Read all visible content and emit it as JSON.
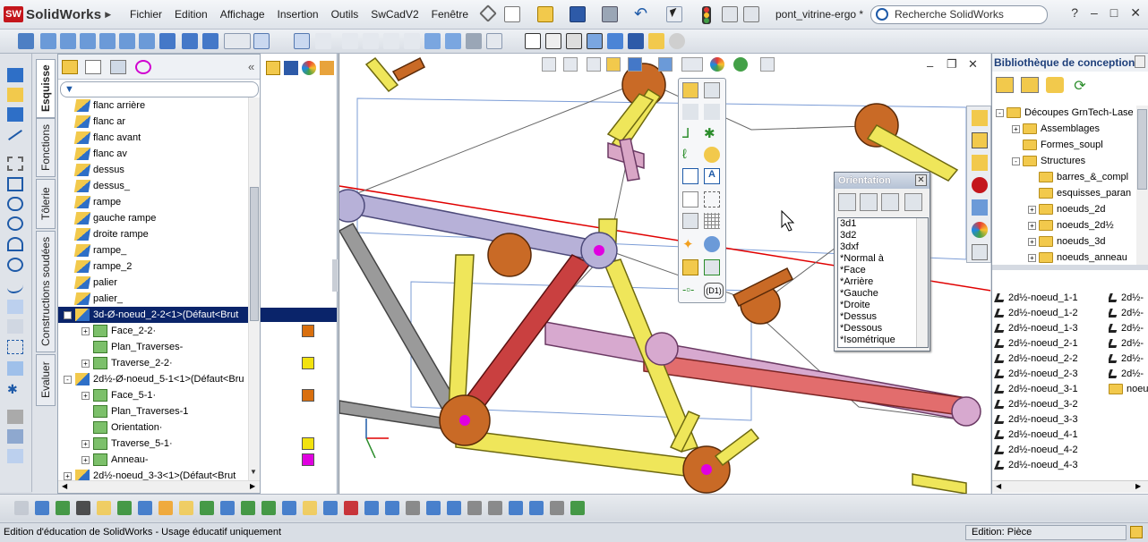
{
  "app": {
    "logo_badge": "SW",
    "name": "SolidWorks",
    "document_title": "pont_vitrine-ergo *"
  },
  "menu": [
    "Fichier",
    "Edition",
    "Affichage",
    "Insertion",
    "Outils",
    "SwCadV2",
    "Fenêtre"
  ],
  "search": {
    "placeholder": "Recherche SolidWorks"
  },
  "window_controls": [
    "?",
    "–",
    "□",
    "✕"
  ],
  "left_tabs": [
    "Esquisse",
    "Fonctions",
    "Tôlerie",
    "Constructions soudées",
    "Evaluer"
  ],
  "tree": [
    {
      "label": "flanc arrière",
      "indent": 0
    },
    {
      "label": "flanc ar",
      "indent": 0
    },
    {
      "label": "flanc avant",
      "indent": 0
    },
    {
      "label": "flanc av",
      "indent": 0
    },
    {
      "label": "dessus",
      "indent": 0
    },
    {
      "label": "dessus_",
      "indent": 0
    },
    {
      "label": "rampe",
      "indent": 0
    },
    {
      "label": "gauche rampe",
      "indent": 0
    },
    {
      "label": "droite rampe",
      "indent": 0
    },
    {
      "label": "rampe_",
      "indent": 0
    },
    {
      "label": "rampe_2",
      "indent": 0
    },
    {
      "label": "palier",
      "indent": 0
    },
    {
      "label": "palier_",
      "indent": 0
    },
    {
      "label": "3d-Ø-noeud_2-2<1>(Défaut<Brut",
      "indent": 0,
      "selected": true,
      "expander": "-"
    },
    {
      "label": "Face_2-2·",
      "indent": 1,
      "expander": "+"
    },
    {
      "label": "Plan_Traverses-",
      "indent": 1
    },
    {
      "label": "Traverse_2-2·",
      "indent": 1,
      "expander": "+"
    },
    {
      "label": "2d½-Ø-noeud_5-1<1>(Défaut<Bru",
      "indent": 0,
      "expander": "-"
    },
    {
      "label": "Face_5-1·",
      "indent": 1,
      "expander": "+"
    },
    {
      "label": "Plan_Traverses-1",
      "indent": 1
    },
    {
      "label": "Orientation·",
      "indent": 1
    },
    {
      "label": "Traverse_5-1·",
      "indent": 1,
      "expander": "+"
    },
    {
      "label": "Anneau-",
      "indent": 1,
      "expander": "+"
    },
    {
      "label": "2d½-noeud_3-3<1>(Défaut<Brut",
      "indent": 0,
      "expander": "+"
    }
  ],
  "orientation_dialog": {
    "title": "Orientation",
    "views": [
      "3d1",
      "3d2",
      "3dxf",
      "*Normal à",
      "*Face",
      "*Arrière",
      "*Gauche",
      "*Droite",
      "*Dessus",
      "*Dessous",
      "*Isométrique"
    ]
  },
  "library": {
    "title": "Bibliothèque de conception",
    "tree": [
      {
        "label": "Découpes GrnTech-Lase",
        "indent": 0,
        "expander": "-"
      },
      {
        "label": "Assemblages",
        "indent": 1,
        "expander": "+"
      },
      {
        "label": "Formes_soupl",
        "indent": 1
      },
      {
        "label": "Structures",
        "indent": 1,
        "expander": "-"
      },
      {
        "label": "barres_&_compl",
        "indent": 2
      },
      {
        "label": "esquisses_paran",
        "indent": 2
      },
      {
        "label": "noeuds_2d",
        "indent": 2,
        "expander": "+"
      },
      {
        "label": "noeuds_2d½",
        "indent": 2,
        "expander": "+"
      },
      {
        "label": "noeuds_3d",
        "indent": 2,
        "expander": "+"
      },
      {
        "label": "noeuds_anneau",
        "indent": 2,
        "expander": "+"
      }
    ],
    "parts": [
      "2d½-noeud_1-1",
      "2d½-noeud_1-2",
      "2d½-noeud_1-3",
      "2d½-noeud_2-1",
      "2d½-noeud_2-2",
      "2d½-noeud_2-3",
      "2d½-noeud_3-1",
      "2d½-noeud_3-2",
      "2d½-noeud_3-3",
      "2d½-noeud_4-1",
      "2d½-noeud_4-2",
      "2d½-noeud_4-3"
    ],
    "parts_col2": [
      "2d½-",
      "2d½-",
      "2d½-",
      "2d½-",
      "2d½-",
      "2d½-",
      "noeu"
    ]
  },
  "status": {
    "text": "Edition d'éducation de SolidWorks - Usage éducatif uniquement",
    "mode": "Edition: Pièce"
  },
  "colors": {
    "selection": "#0a246a",
    "accent": "#1e5aa8",
    "brand_red": "#c4161c",
    "orange": "#d96f0e",
    "yellow": "#f2e20f",
    "magenta": "#e000e0",
    "red_plane": "#e00000"
  }
}
